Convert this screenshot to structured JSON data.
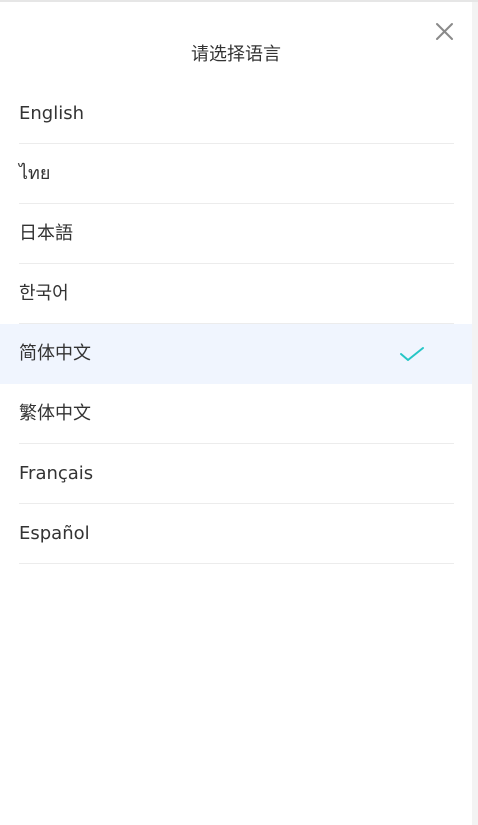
{
  "modal": {
    "title": "请选择语言"
  },
  "icons": {
    "close": "close-icon",
    "selected": "checkmark-icon"
  },
  "colors": {
    "selected_background": "#f0f5fe",
    "check_color": "#26c6c6",
    "text": "#333333",
    "divider": "#ececec"
  },
  "languages": [
    {
      "label": "English",
      "selected": false
    },
    {
      "label": "ไทย",
      "selected": false
    },
    {
      "label": "日本語",
      "selected": false
    },
    {
      "label": "한국어",
      "selected": false
    },
    {
      "label": "简体中文",
      "selected": true
    },
    {
      "label": "繁体中文",
      "selected": false
    },
    {
      "label": "Français",
      "selected": false
    },
    {
      "label": "Español",
      "selected": false
    }
  ]
}
